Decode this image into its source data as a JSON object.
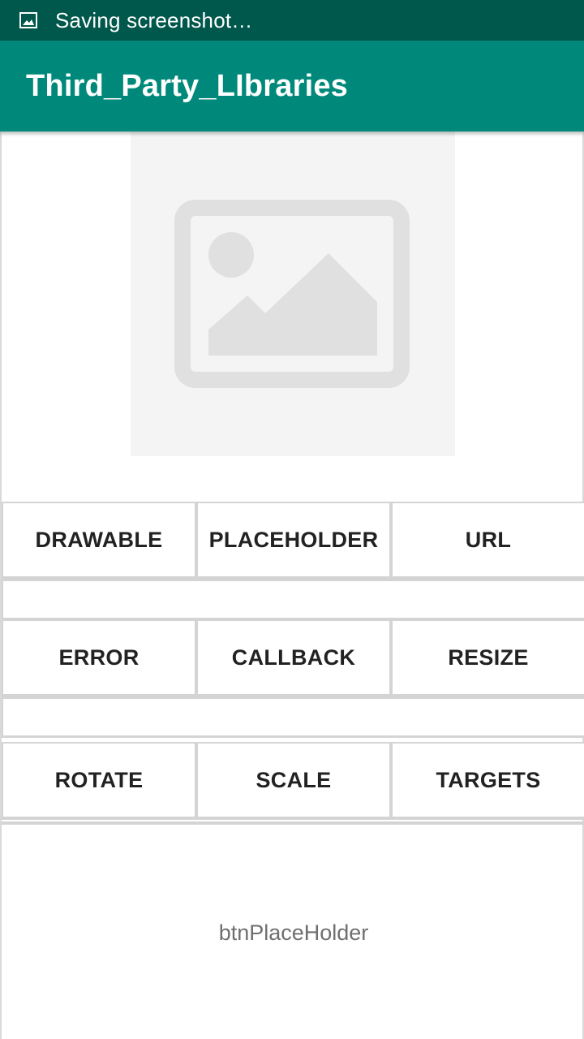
{
  "status_bar": {
    "notification_icon": "image-icon",
    "text": "Saving screenshot…",
    "background_color": "#00574b"
  },
  "app_bar": {
    "title": "Third_Party_LIbraries",
    "background_color": "#00897b"
  },
  "image_view": {
    "icon": "image-placeholder-icon"
  },
  "buttons": {
    "row1": [
      "DRAWABLE",
      "PLACEHOLDER",
      "URL"
    ],
    "row2": [
      "ERROR",
      "CALLBACK",
      "RESIZE"
    ],
    "row3": [
      "ROTATE",
      "SCALE",
      "TARGETS"
    ]
  },
  "bottom_panel": {
    "label": "btnPlaceHolder"
  }
}
